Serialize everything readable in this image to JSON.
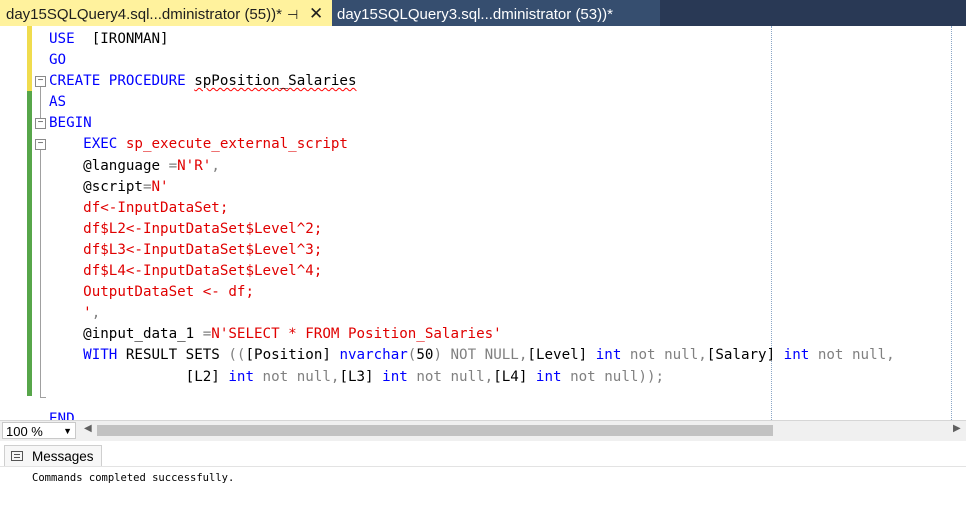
{
  "tabs": [
    {
      "title": "day15SQLQuery4.sql...dministrator (55))*",
      "pin_icon": "⊣",
      "close_icon": "✕"
    },
    {
      "title": "day15SQLQuery3.sql...dministrator (53))*"
    }
  ],
  "code": [
    [
      [
        "kw",
        "USE"
      ],
      [
        "",
        "  [IRONMAN]"
      ]
    ],
    [
      [
        "kw",
        "GO"
      ]
    ],
    [
      [
        "kw",
        "CREATE PROCEDURE "
      ],
      [
        "sq",
        "spPosition_Salaries"
      ]
    ],
    [
      [
        "kw",
        "AS"
      ]
    ],
    [
      [
        "kw",
        "BEGIN"
      ]
    ],
    [
      [
        "",
        "    "
      ],
      [
        "kw",
        "EXEC "
      ],
      [
        "str",
        "sp_execute_external_script"
      ]
    ],
    [
      [
        "",
        "    @language "
      ],
      [
        "gr",
        "="
      ],
      [
        "str",
        "N'R'"
      ],
      [
        "gr",
        ","
      ]
    ],
    [
      [
        "",
        "    @script"
      ],
      [
        "gr",
        "="
      ],
      [
        "str",
        "N'"
      ]
    ],
    [
      [
        "str",
        "    df<-InputDataSet;"
      ]
    ],
    [
      [
        "str",
        "    df$L2<-InputDataSet$Level^2;"
      ]
    ],
    [
      [
        "str",
        "    df$L3<-InputDataSet$Level^3;"
      ]
    ],
    [
      [
        "str",
        "    df$L4<-InputDataSet$Level^4;"
      ]
    ],
    [
      [
        "str",
        "    OutputDataSet <- df;"
      ]
    ],
    [
      [
        "str",
        "    '"
      ],
      [
        "gr",
        ","
      ]
    ],
    [
      [
        "",
        "    @input_data_1 "
      ],
      [
        "gr",
        "="
      ],
      [
        "str",
        "N'SELECT * FROM Position_Salaries'"
      ]
    ],
    [
      [
        "",
        "    "
      ],
      [
        "kw",
        "WITH"
      ],
      [
        "",
        " RESULT SETS "
      ],
      [
        "gr",
        "(("
      ],
      [
        "",
        "[Position] "
      ],
      [
        "kw",
        "nvarchar"
      ],
      [
        "gr",
        "("
      ],
      [
        "",
        "50"
      ],
      [
        "gr",
        ") NOT NULL,"
      ],
      [
        "",
        "[Level] "
      ],
      [
        "kw",
        "int"
      ],
      [
        "gr",
        " not null,"
      ],
      [
        "",
        "[Salary] "
      ],
      [
        "kw",
        "int"
      ],
      [
        "gr",
        " not null,"
      ]
    ],
    [
      [
        "",
        "                "
      ],
      [
        "",
        "[L2] "
      ],
      [
        "kw",
        "int"
      ],
      [
        "gr",
        " not null,"
      ],
      [
        "",
        "[L3] "
      ],
      [
        "kw",
        "int"
      ],
      [
        "gr",
        " not null,"
      ],
      [
        "",
        "[L4] "
      ],
      [
        "kw",
        "int"
      ],
      [
        "gr",
        " not null));"
      ]
    ],
    [
      [
        "",
        " "
      ]
    ],
    [
      [
        "kw",
        "END"
      ]
    ]
  ],
  "zoom": {
    "value": "100 %",
    "dropdown_icon": "▼"
  },
  "scroll": {
    "left_icon": "◀",
    "right_icon": "▶"
  },
  "messages": {
    "tab_label": "Messages",
    "text": "Commands completed successfully."
  }
}
